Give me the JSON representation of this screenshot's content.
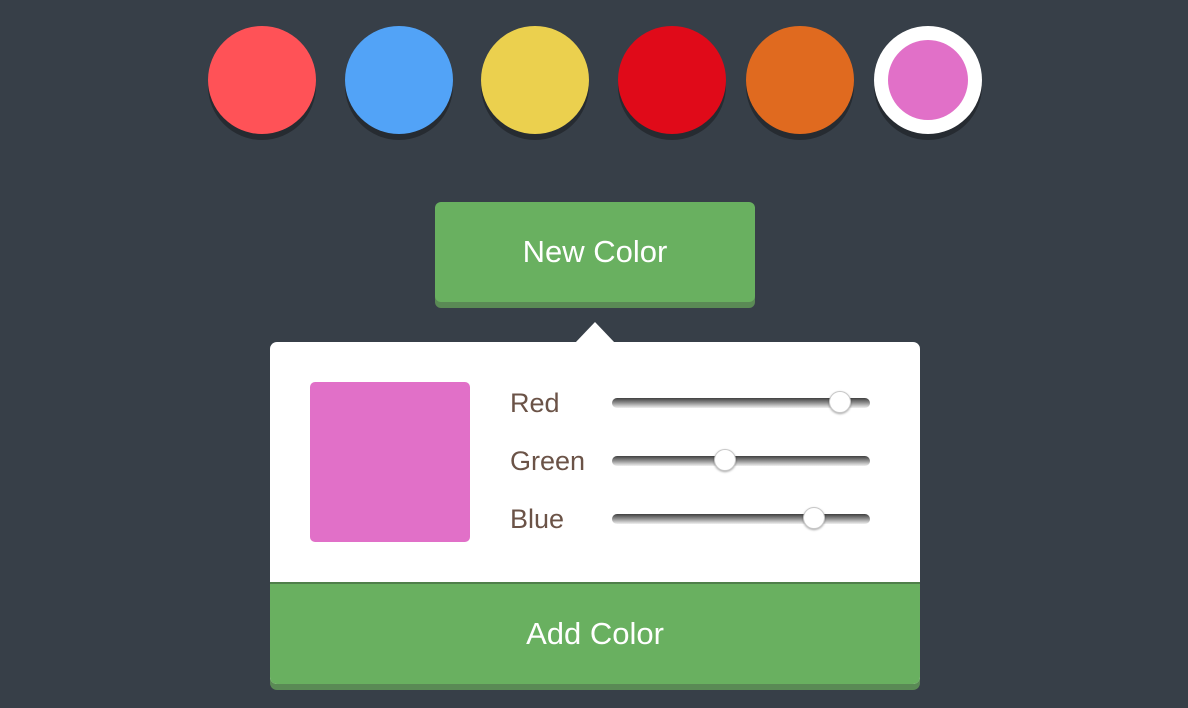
{
  "swatches": [
    {
      "color": "#ff5257",
      "selected": false
    },
    {
      "color": "#52a3f7",
      "selected": false
    },
    {
      "color": "#ebd04e",
      "selected": false
    },
    {
      "color": "#e00a19",
      "selected": false
    },
    {
      "color": "#e06a1f",
      "selected": false
    },
    {
      "color": "#e170c8",
      "selected": true
    }
  ],
  "new_color_button": {
    "label": "New Color"
  },
  "editor": {
    "preview_color": "#e170c8",
    "sliders": [
      {
        "label": "Red",
        "value": 225,
        "max": 255
      },
      {
        "label": "Green",
        "value": 112,
        "max": 255
      },
      {
        "label": "Blue",
        "value": 200,
        "max": 255
      }
    ],
    "add_button": {
      "label": "Add Color"
    }
  },
  "colors": {
    "background": "#373f48",
    "button_green": "#69b060",
    "label_brown": "#6b5347"
  }
}
